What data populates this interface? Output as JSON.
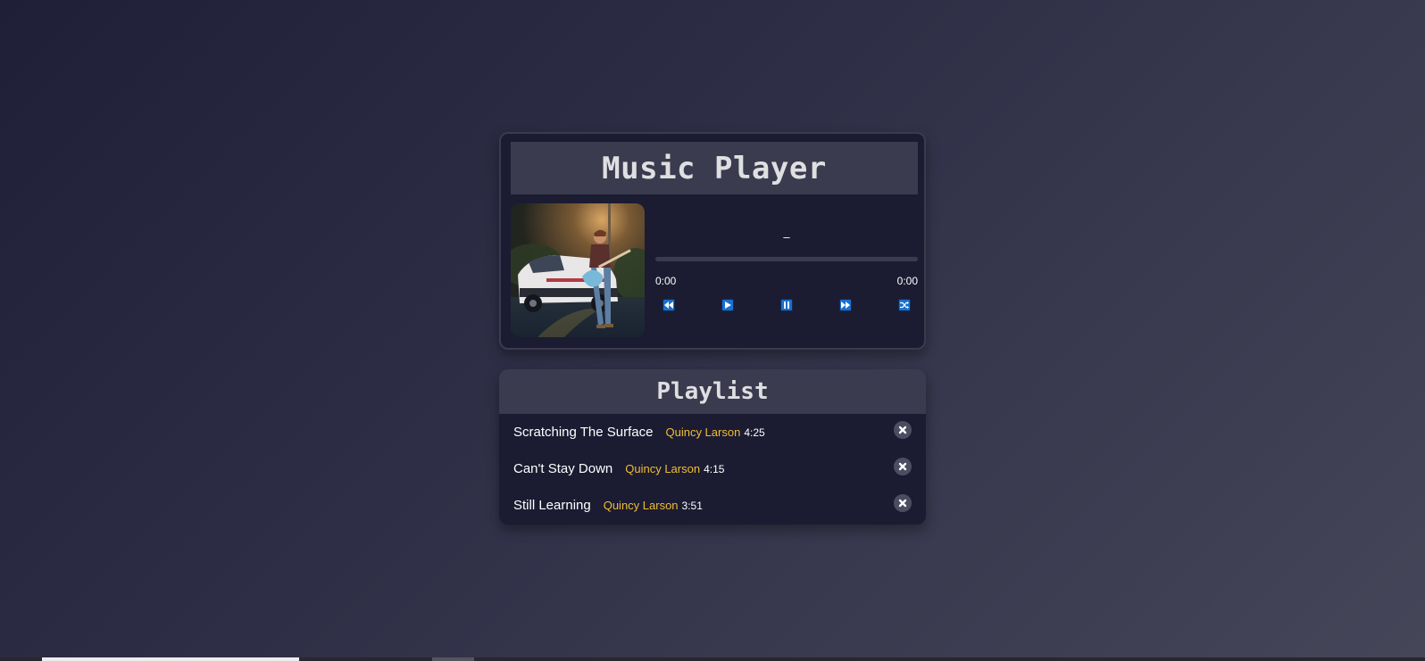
{
  "player": {
    "title": "Music Player",
    "song_info": "–",
    "progress_percent": 0,
    "current_time": "0:00",
    "total_time": "0:00",
    "controls": [
      {
        "name": "previous-button",
        "icon": "previous-icon"
      },
      {
        "name": "play-button",
        "icon": "play-icon"
      },
      {
        "name": "pause-button",
        "icon": "pause-icon"
      },
      {
        "name": "next-button",
        "icon": "next-icon"
      },
      {
        "name": "shuffle-button",
        "icon": "shuffle-icon"
      }
    ]
  },
  "playlist": {
    "title": "Playlist",
    "songs": [
      {
        "title": "Scratching The Surface",
        "artist": "Quincy Larson",
        "duration": "4:25"
      },
      {
        "title": "Can't Stay Down",
        "artist": "Quincy Larson",
        "duration": "4:15"
      },
      {
        "title": "Still Learning",
        "artist": "Quincy Larson",
        "duration": "3:51"
      }
    ]
  },
  "colors": {
    "background_dark": "#1b1b32",
    "panel_header": "#3b3b4f",
    "accent_artist": "#f1be32",
    "control_button": "#1a6fcd"
  }
}
